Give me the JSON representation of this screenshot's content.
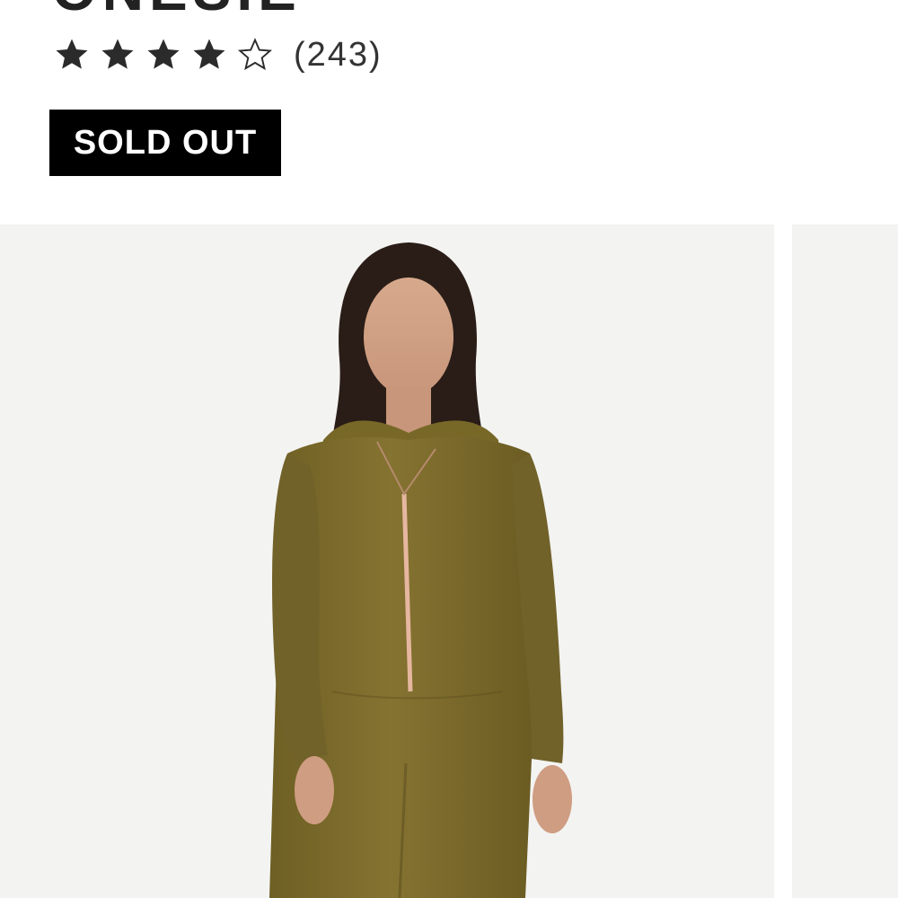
{
  "product": {
    "title_partial": "ONESIE",
    "rating": {
      "stars_filled": 4,
      "stars_total": 5,
      "review_count": "(243)"
    },
    "status_badge": "SOLD OUT"
  },
  "gallery": {
    "images": [
      {
        "description": "model wearing khaki glitter hooded zip onesie"
      },
      {
        "description": "next product image (partially visible)"
      }
    ]
  },
  "colors": {
    "star": "#2b2b2b",
    "badge_bg": "#000000",
    "badge_text": "#ffffff",
    "garment": "#7a6a2a"
  }
}
